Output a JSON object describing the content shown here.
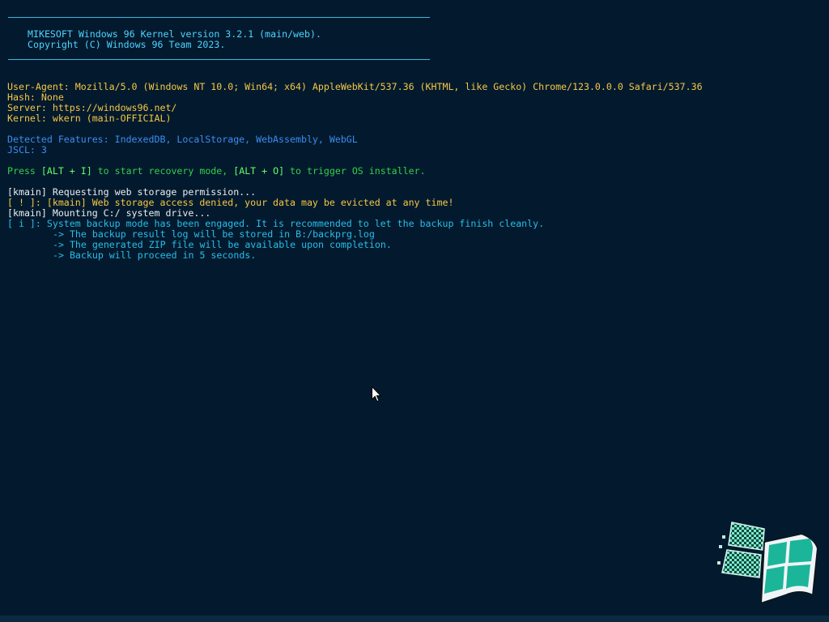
{
  "banner": {
    "line1": "MIKESOFT Windows 96 Kernel version 3.2.1 (main/web).",
    "line2": "Copyright (C) Windows 96 Team 2023."
  },
  "info": {
    "user_agent": "User-Agent: Mozilla/5.0 (Windows NT 10.0; Win64; x64) AppleWebKit/537.36 (KHTML, like Gecko) Chrome/123.0.0.0 Safari/537.36",
    "hash": "Hash: None",
    "server": "Server: https://windows96.net/",
    "kernel": "Kernel: wkern (main-OFFICIAL)"
  },
  "features": {
    "detected": "Detected Features: IndexedDB, LocalStorage, WebAssembly, WebGL",
    "jscl": "JSCL: 3"
  },
  "recovery": {
    "prefix": "Press ",
    "key1": "[ALT + I]",
    "middle": " to start recovery mode, ",
    "key2": "[ALT + O]",
    "suffix": " to trigger OS installer."
  },
  "log": {
    "request_storage": "[kmain] Requesting web storage permission...",
    "denied": "[ ! ]: [kmain] Web storage access denied, your data may be evicted at any time!",
    "mounting": "[kmain] Mounting C:/ system drive...",
    "backup_engaged": "[ i ]: System backup mode has been engaged. It is recommended to let the backup finish cleanly.",
    "backup_log": "-> The backup result log will be stored in B:/backprg.log",
    "backup_zip": "-> The generated ZIP file will be available upon completion.",
    "backup_countdown": "-> Backup will proceed in 5 seconds."
  },
  "colors": {
    "background": "#031a2e",
    "banner": "#4fd3ff",
    "info": "#f6c744",
    "features": "#3c8cf0",
    "recovery": "#35cf49",
    "log": "#e9eef2",
    "notice": "#29bde9"
  },
  "icons": {
    "cursor": "mouse-pointer-icon",
    "logo": "windows-96-logo-icon"
  }
}
